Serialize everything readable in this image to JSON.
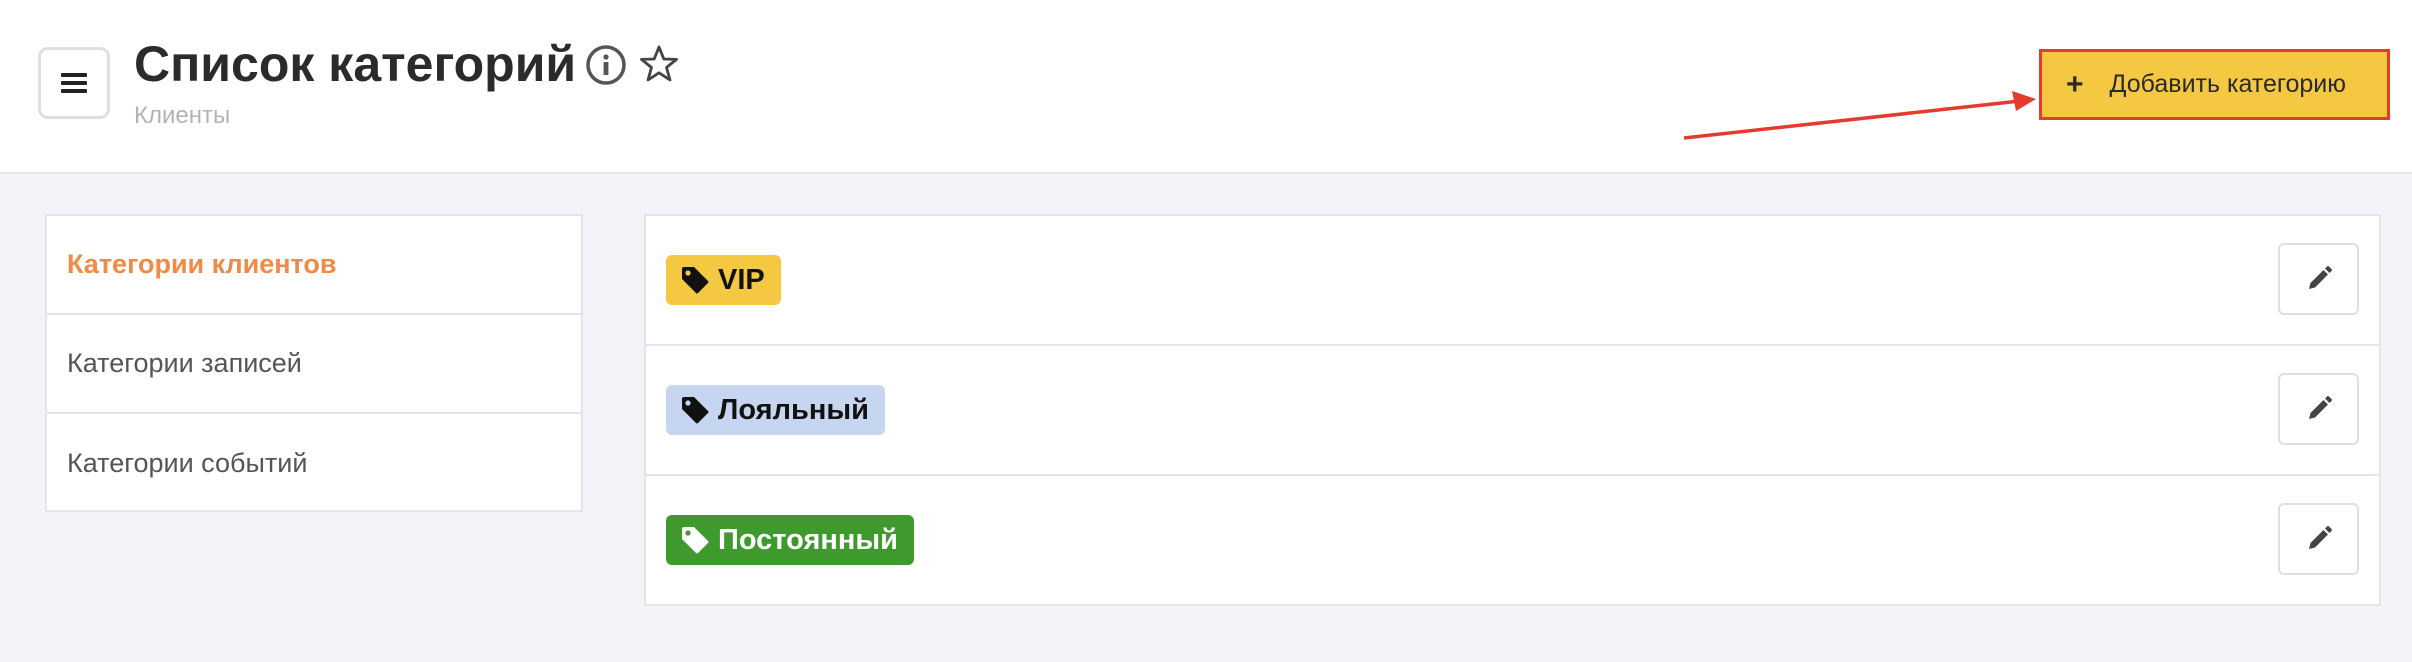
{
  "header": {
    "title": "Список категорий",
    "subtitle": "Клиенты",
    "menu_icon": "hamburger-menu-icon",
    "info_icon": "info-icon",
    "star_icon": "star-icon",
    "add_button_label": "Добавить категорию",
    "add_button_icon": "plus",
    "add_button_color": "#f5c842",
    "highlight_color": "#e53b2c"
  },
  "sidebar": {
    "items": [
      {
        "label": "Категории клиентов",
        "active": true
      },
      {
        "label": "Категории записей",
        "active": false
      },
      {
        "label": "Категории событий",
        "active": false
      }
    ],
    "active_color": "#ef8b45"
  },
  "categories": [
    {
      "name": "VIP",
      "bg": "#f5c842",
      "fg": "#111111",
      "icon": "tag-icon"
    },
    {
      "name": "Лояльный",
      "bg": "#c6d5f0",
      "fg": "#111111",
      "icon": "tag-icon"
    },
    {
      "name": "Постоянный",
      "bg": "#3e9a2c",
      "fg": "#ffffff",
      "icon": "tag-icon"
    }
  ],
  "edit_icon": "pencil-icon"
}
